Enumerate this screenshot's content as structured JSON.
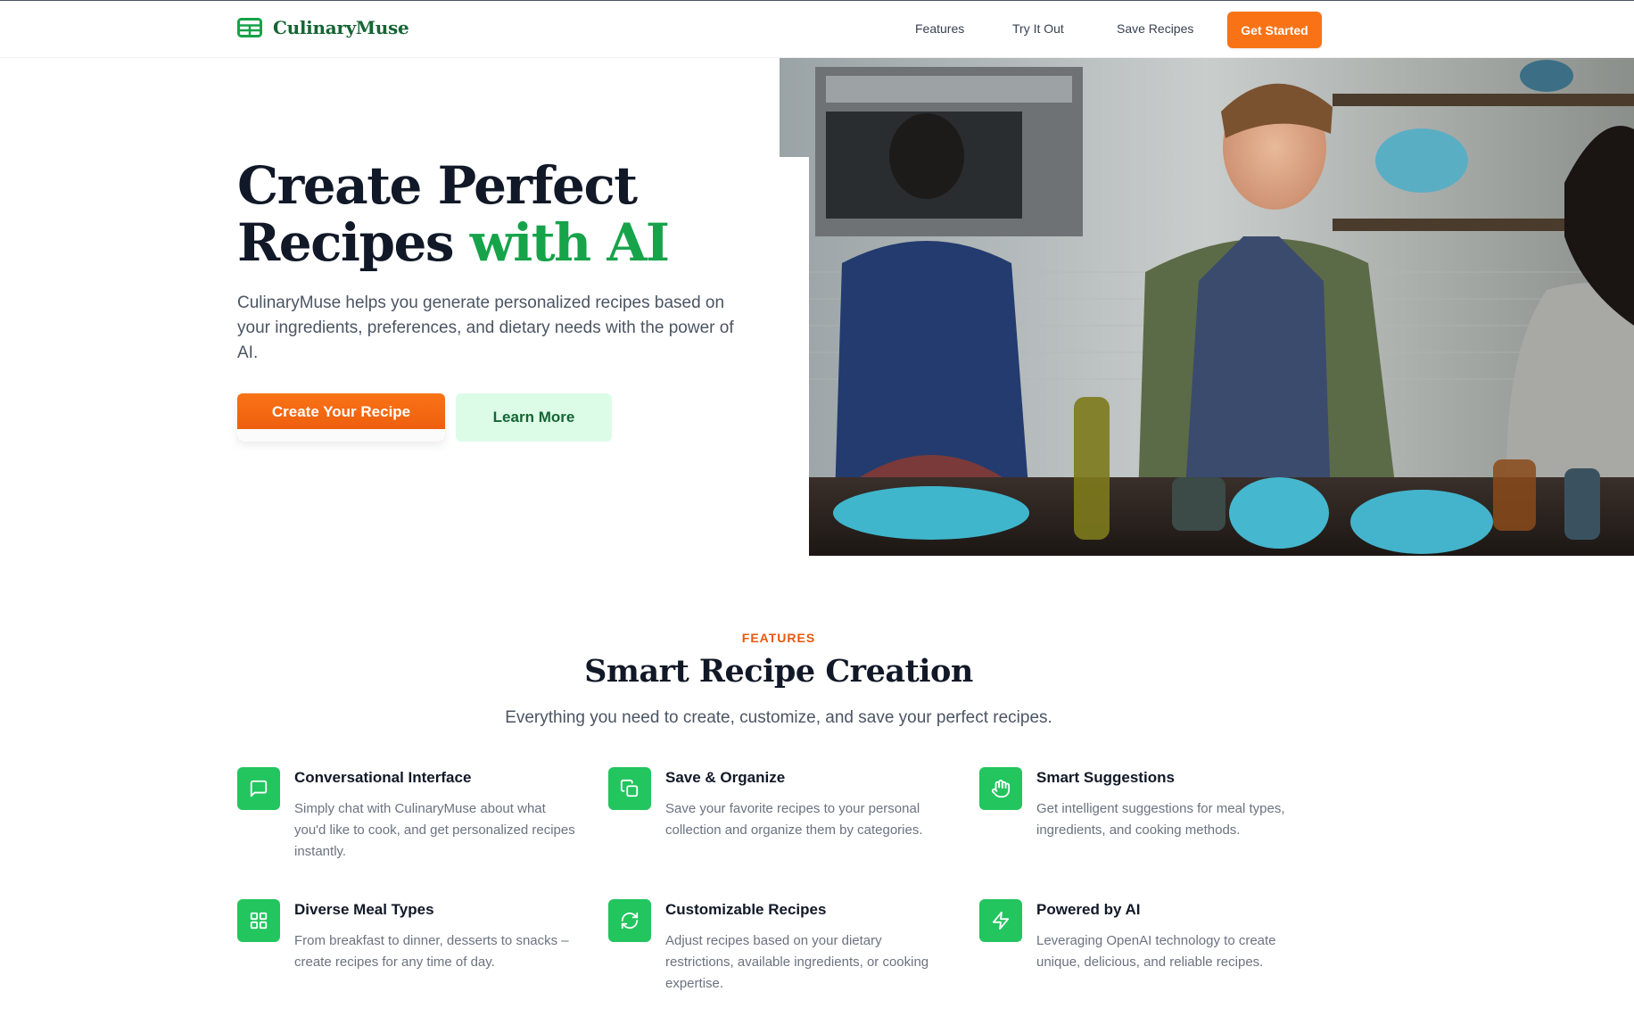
{
  "header": {
    "logo_text": "CulinaryMuse",
    "nav": [
      "Features",
      "Try It Out",
      "Save Recipes"
    ],
    "cta_label": "Get Started"
  },
  "hero": {
    "title_line1": "Create Perfect",
    "title_line2_plain": "Recipes ",
    "title_line2_accent": "with AI",
    "description": "CulinaryMuse helps you generate personalized recipes based on your ingredients, preferences, and dietary needs with the power of AI.",
    "primary_button": "Create Your Recipe",
    "secondary_button": "Learn More",
    "image_alt": "people cooking in a kitchen"
  },
  "features": {
    "eyebrow": "FEATURES",
    "title": "Smart Recipe Creation",
    "subtitle": "Everything you need to create, customize, and save your perfect recipes.",
    "items": [
      {
        "icon": "chat-icon",
        "title": "Conversational Interface",
        "description": "Simply chat with CulinaryMuse about what you'd like to cook, and get personalized recipes instantly."
      },
      {
        "icon": "copy-icon",
        "title": "Save & Organize",
        "description": "Save your favorite recipes to your personal collection and organize them by categories."
      },
      {
        "icon": "hand-icon",
        "title": "Smart Suggestions",
        "description": "Get intelligent suggestions for meal types, ingredients, and cooking methods."
      },
      {
        "icon": "grid-icon",
        "title": "Diverse Meal Types",
        "description": "From breakfast to dinner, desserts to snacks – create recipes for any time of day."
      },
      {
        "icon": "refresh-icon",
        "title": "Customizable Recipes",
        "description": "Adjust recipes based on your dietary restrictions, available ingredients, or cooking expertise."
      },
      {
        "icon": "lightning-icon",
        "title": "Powered by AI",
        "description": "Leveraging OpenAI technology to create unique, delicious, and reliable recipes."
      }
    ]
  },
  "colors": {
    "brand_green": "#16a34a",
    "dark_green": "#166534",
    "accent_orange": "#f97316",
    "icon_green": "#22c55e"
  }
}
